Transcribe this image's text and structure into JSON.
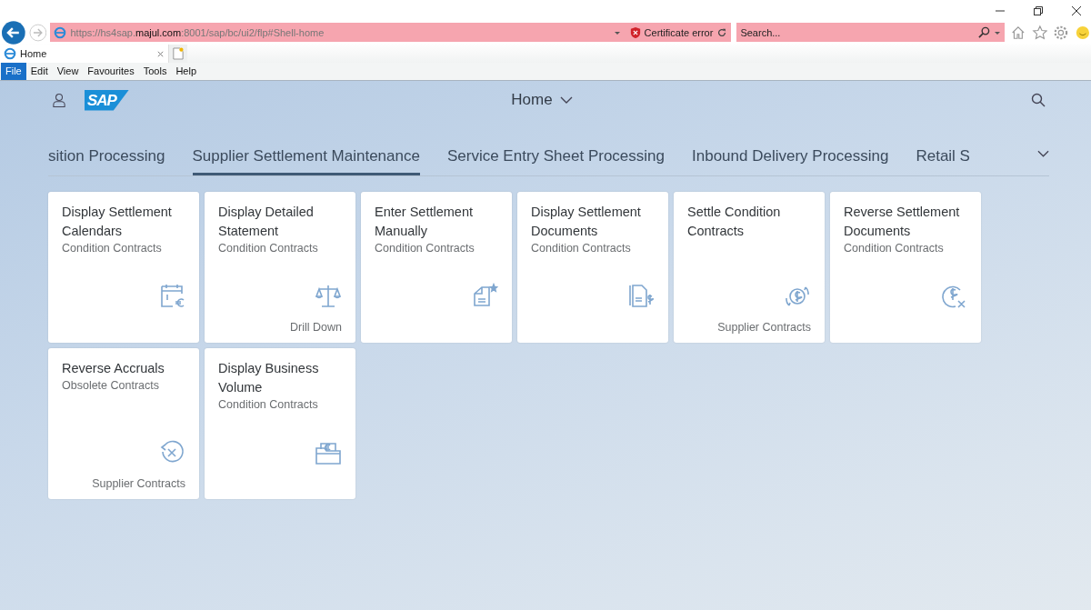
{
  "browser": {
    "address": "https://hs4sap.**majul.com**:8001/sap/bc/ui2/flp#Shell-home",
    "certificate_warning": "Certificate error",
    "search": {
      "placeholder": "Search..."
    },
    "tabs": [
      {
        "label": "Home",
        "selected": true
      }
    ],
    "menu": [
      {
        "label": "File",
        "selected": true
      },
      {
        "label": "Edit",
        "selected": false
      },
      {
        "label": "View",
        "selected": false
      },
      {
        "label": "Favourites",
        "selected": false
      },
      {
        "label": "Tools",
        "selected": false
      },
      {
        "label": "Help",
        "selected": false
      }
    ]
  },
  "shell": {
    "title": "Home",
    "logo": "SAP"
  },
  "groups": [
    {
      "label": "sition Processing",
      "selected": false
    },
    {
      "label": "Supplier Settlement Maintenance",
      "selected": true
    },
    {
      "label": "Service Entry Sheet Processing",
      "selected": false
    },
    {
      "label": "Inbound Delivery Processing",
      "selected": false
    },
    {
      "label": "Retail S",
      "selected": false
    }
  ],
  "tiles": [
    {
      "title": "Display Settlement Calendars",
      "subtitle": "Condition Contracts"
    },
    {
      "title": "Display Detailed Statement",
      "subtitle": "Condition Contracts",
      "footer": "Drill Down"
    },
    {
      "title": "Enter Settlement Manually",
      "subtitle": "Condition Contracts"
    },
    {
      "title": "Display Settlement Documents",
      "subtitle": "Condition Contracts"
    },
    {
      "title": "Settle Condition Contracts",
      "footer": "Supplier Contracts"
    },
    {
      "title": "Reverse Settlement Documents",
      "subtitle": "Condition Contracts"
    },
    {
      "title": "Reverse Accruals",
      "subtitle": "Obsolete Contracts",
      "footer": "Supplier Contracts"
    },
    {
      "title": "Display Business Volume",
      "subtitle": "Condition Contracts"
    }
  ]
}
